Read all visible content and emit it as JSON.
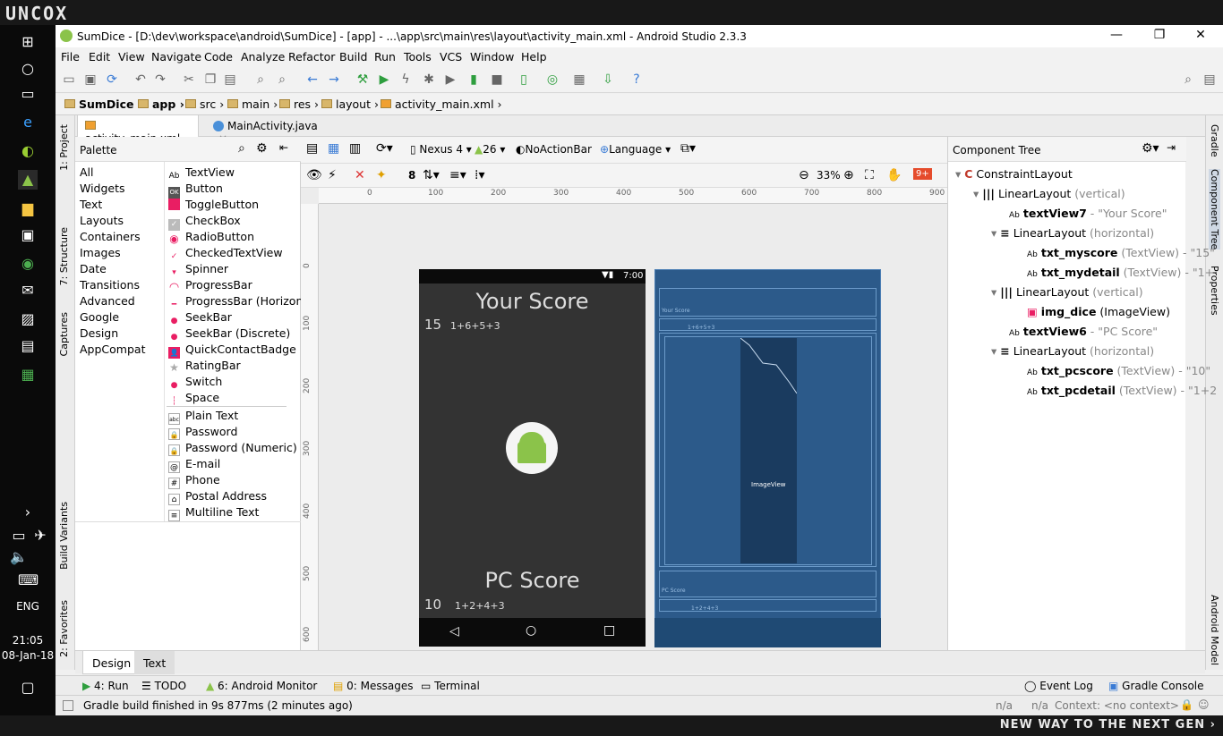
{
  "brand": "UNCOX",
  "tagline": "NEW WAY TO THE NEXT GEN ›",
  "taskbar": {
    "lang": "ENG",
    "time": "21:05",
    "date": "08-Jan-18"
  },
  "window": {
    "title": "SumDice - [D:\\dev\\workspace\\android\\SumDice] - [app] - ...\\app\\src\\main\\res\\layout\\activity_main.xml - Android Studio 2.3.3",
    "minimize": "—",
    "maximize": "❐",
    "close": "✕"
  },
  "menu": [
    "File",
    "Edit",
    "View",
    "Navigate",
    "Code",
    "Analyze",
    "Refactor",
    "Build",
    "Run",
    "Tools",
    "VCS",
    "Window",
    "Help"
  ],
  "breadcrumbs": [
    "SumDice",
    "app",
    "src",
    "main",
    "res",
    "layout",
    "activity_main.xml"
  ],
  "file_tabs": [
    {
      "label": "activity_main.xml",
      "close": "×"
    },
    {
      "label": "MainActivity.java",
      "close": "×"
    }
  ],
  "left_tool_tabs": [
    "1: Project",
    "7: Structure",
    "Captures",
    "Build Variants",
    "2: Favorites"
  ],
  "right_tool_tabs": [
    "Gradle",
    "Component Tree",
    "Properties",
    "Android Model"
  ],
  "palette": {
    "title": "Palette",
    "categories": [
      "All",
      "Widgets",
      "Text",
      "Layouts",
      "Containers",
      "Images",
      "Date",
      "Transitions",
      "Advanced",
      "Google",
      "Design",
      "AppCompat"
    ],
    "widgets": [
      {
        "icon": "Ab",
        "label": "TextView"
      },
      {
        "icon": "OK",
        "label": "Button"
      },
      {
        "icon": "",
        "label": "ToggleButton"
      },
      {
        "icon": "✓",
        "label": "CheckBox"
      },
      {
        "icon": "◉",
        "label": "RadioButton"
      },
      {
        "icon": "✓",
        "label": "CheckedTextView"
      },
      {
        "icon": "▾",
        "label": "Spinner"
      },
      {
        "icon": "◠",
        "label": "ProgressBar"
      },
      {
        "icon": "━",
        "label": "ProgressBar (Horizont"
      },
      {
        "icon": "●",
        "label": "SeekBar"
      },
      {
        "icon": "●",
        "label": "SeekBar (Discrete)"
      },
      {
        "icon": "👤",
        "label": "QuickContactBadge"
      },
      {
        "icon": "★",
        "label": "RatingBar"
      },
      {
        "icon": "●",
        "label": "Switch"
      },
      {
        "icon": "┆",
        "label": "Space"
      }
    ],
    "text_fields": [
      {
        "icon": "abc",
        "label": "Plain Text"
      },
      {
        "icon": "🔒",
        "label": "Password"
      },
      {
        "icon": "🔒",
        "label": "Password (Numeric)"
      },
      {
        "icon": "@",
        "label": "E-mail"
      },
      {
        "icon": "#",
        "label": "Phone"
      },
      {
        "icon": "⌂",
        "label": "Postal Address"
      },
      {
        "icon": "≡",
        "label": "Multiline Text"
      }
    ]
  },
  "editor_toolbar": {
    "device": "Nexus 4",
    "api": "26",
    "theme": "NoActionBar",
    "language": "Language",
    "margin": "8",
    "zoom": "33%",
    "issues": "9+"
  },
  "ruler_h": [
    "0",
    "100",
    "200",
    "300",
    "400",
    "500",
    "600",
    "700",
    "800",
    "900"
  ],
  "ruler_v": [
    "0",
    "100",
    "200",
    "300",
    "400",
    "500",
    "600"
  ],
  "phone": {
    "time": "7:00",
    "your_score": "Your Score",
    "my_score": "15",
    "my_detail": "1+6+5+3",
    "pc_score_label": "PC Score",
    "pc_score": "10",
    "pc_detail": "1+2+4+3"
  },
  "blueprint": {
    "your_score": "Your Score",
    "my_detail": "1+6+5+3",
    "imageview": "ImageView",
    "pc_score": "PC Score",
    "pc_detail": "1+2+4+3"
  },
  "component_tree": {
    "title": "Component Tree",
    "nodes": [
      {
        "icon": "C",
        "name": "ConstraintLayout",
        "detail": ""
      },
      {
        "icon": "|||",
        "name": "LinearLayout",
        "detail": " (vertical)"
      },
      {
        "icon": "Ab",
        "name": "textView7",
        "detail": " - \"Your Score\""
      },
      {
        "icon": "≡",
        "name": "LinearLayout",
        "detail": " (horizontal)"
      },
      {
        "icon": "Ab",
        "name": "txt_myscore",
        "detail": " (TextView) - \"15\""
      },
      {
        "icon": "Ab",
        "name": "txt_mydetail",
        "detail": " (TextView) - \"1+"
      },
      {
        "icon": "|||",
        "name": "LinearLayout",
        "detail": " (vertical)"
      },
      {
        "icon": "▣",
        "name": "img_dice",
        "detail": " (ImageView)"
      },
      {
        "icon": "Ab",
        "name": "textView6",
        "detail": " - \"PC Score\""
      },
      {
        "icon": "≡",
        "name": "LinearLayout",
        "detail": " (horizontal)"
      },
      {
        "icon": "Ab",
        "name": "txt_pcscore",
        "detail": " (TextView) - \"10\""
      },
      {
        "icon": "Ab",
        "name": "txt_pcdetail",
        "detail": " (TextView) - \"1+2"
      }
    ]
  },
  "design_tabs": [
    "Design",
    "Text"
  ],
  "tool_windows": {
    "run": "4: Run",
    "todo": "TODO",
    "monitor": "6: Android Monitor",
    "messages": "0: Messages",
    "terminal": "Terminal",
    "event_log": "Event Log",
    "gradle_console": "Gradle Console"
  },
  "status": {
    "message": "Gradle build finished in 9s 877ms (2 minutes ago)",
    "na1": "n/a",
    "na2": "n/a",
    "context": "Context: <no context>"
  },
  "colors": {
    "accent": "#2c5a8a",
    "phone_bg": "#333333",
    "android_green": "#8bc34a"
  }
}
